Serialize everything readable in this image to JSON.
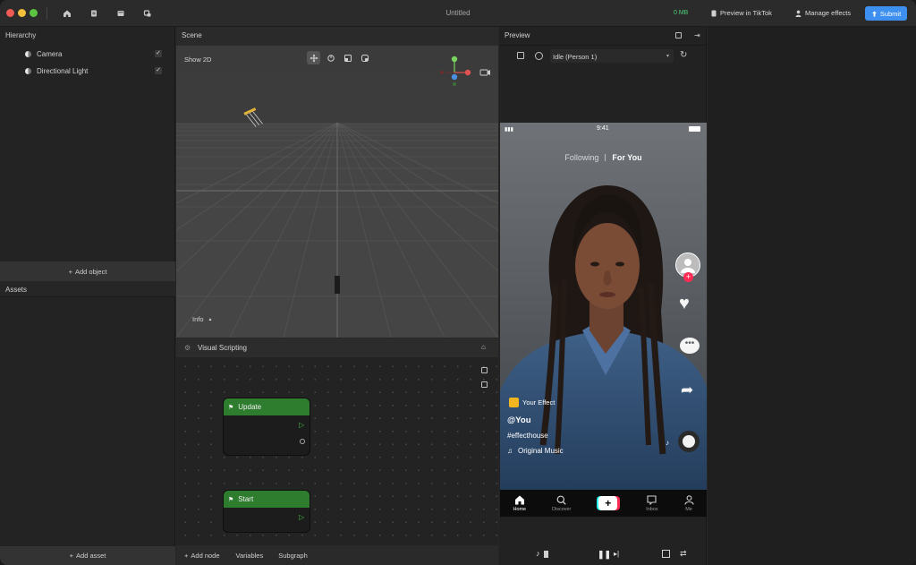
{
  "window": {
    "title": "Untitled",
    "memory": "0 MB",
    "preview_label": "Preview in TikTok",
    "manage_label": "Manage effects",
    "submit_label": "Submit"
  },
  "hierarchy": {
    "title": "Hierarchy",
    "items": [
      {
        "label": "Camera",
        "checked": true
      },
      {
        "label": "Directional Light",
        "checked": true
      }
    ],
    "add_object_label": "Add object"
  },
  "assets": {
    "title": "Assets",
    "add_asset_label": "Add asset"
  },
  "scene": {
    "title": "Scene",
    "show2d_label": "Show 2D",
    "info_label": "Info"
  },
  "visual_scripting": {
    "title": "Visual Scripting",
    "nodes": [
      {
        "label": "Update"
      },
      {
        "label": "Start"
      }
    ],
    "footer": {
      "add_node_label": "Add node",
      "variables_label": "Variables",
      "subgraph_label": "Subgraph"
    }
  },
  "preview": {
    "title": "Preview",
    "animation_select": "Idle (Person 1)",
    "phone": {
      "time": "9:41",
      "tab_following": "Following",
      "tab_for_you": "For You",
      "effect_name": "Your Effect",
      "username": "@You",
      "hashtag": "#effecthouse",
      "music": "Original Music",
      "nav": [
        {
          "label": "Home",
          "icon": "home-icon",
          "active": true
        },
        {
          "label": "Discover",
          "icon": "search-icon",
          "active": false
        },
        {
          "label": "",
          "icon": "create-plus-icon",
          "active": false
        },
        {
          "label": "Inbox",
          "icon": "inbox-icon",
          "active": false
        },
        {
          "label": "Me",
          "icon": "person-icon",
          "active": false
        }
      ]
    }
  },
  "colors": {
    "accent": "#3d8ff0",
    "memory": "#4fd07a",
    "node_header": "#2e7d2e",
    "tiktok_red": "#fe2c55",
    "tiktok_cyan": "#25f4ee"
  }
}
